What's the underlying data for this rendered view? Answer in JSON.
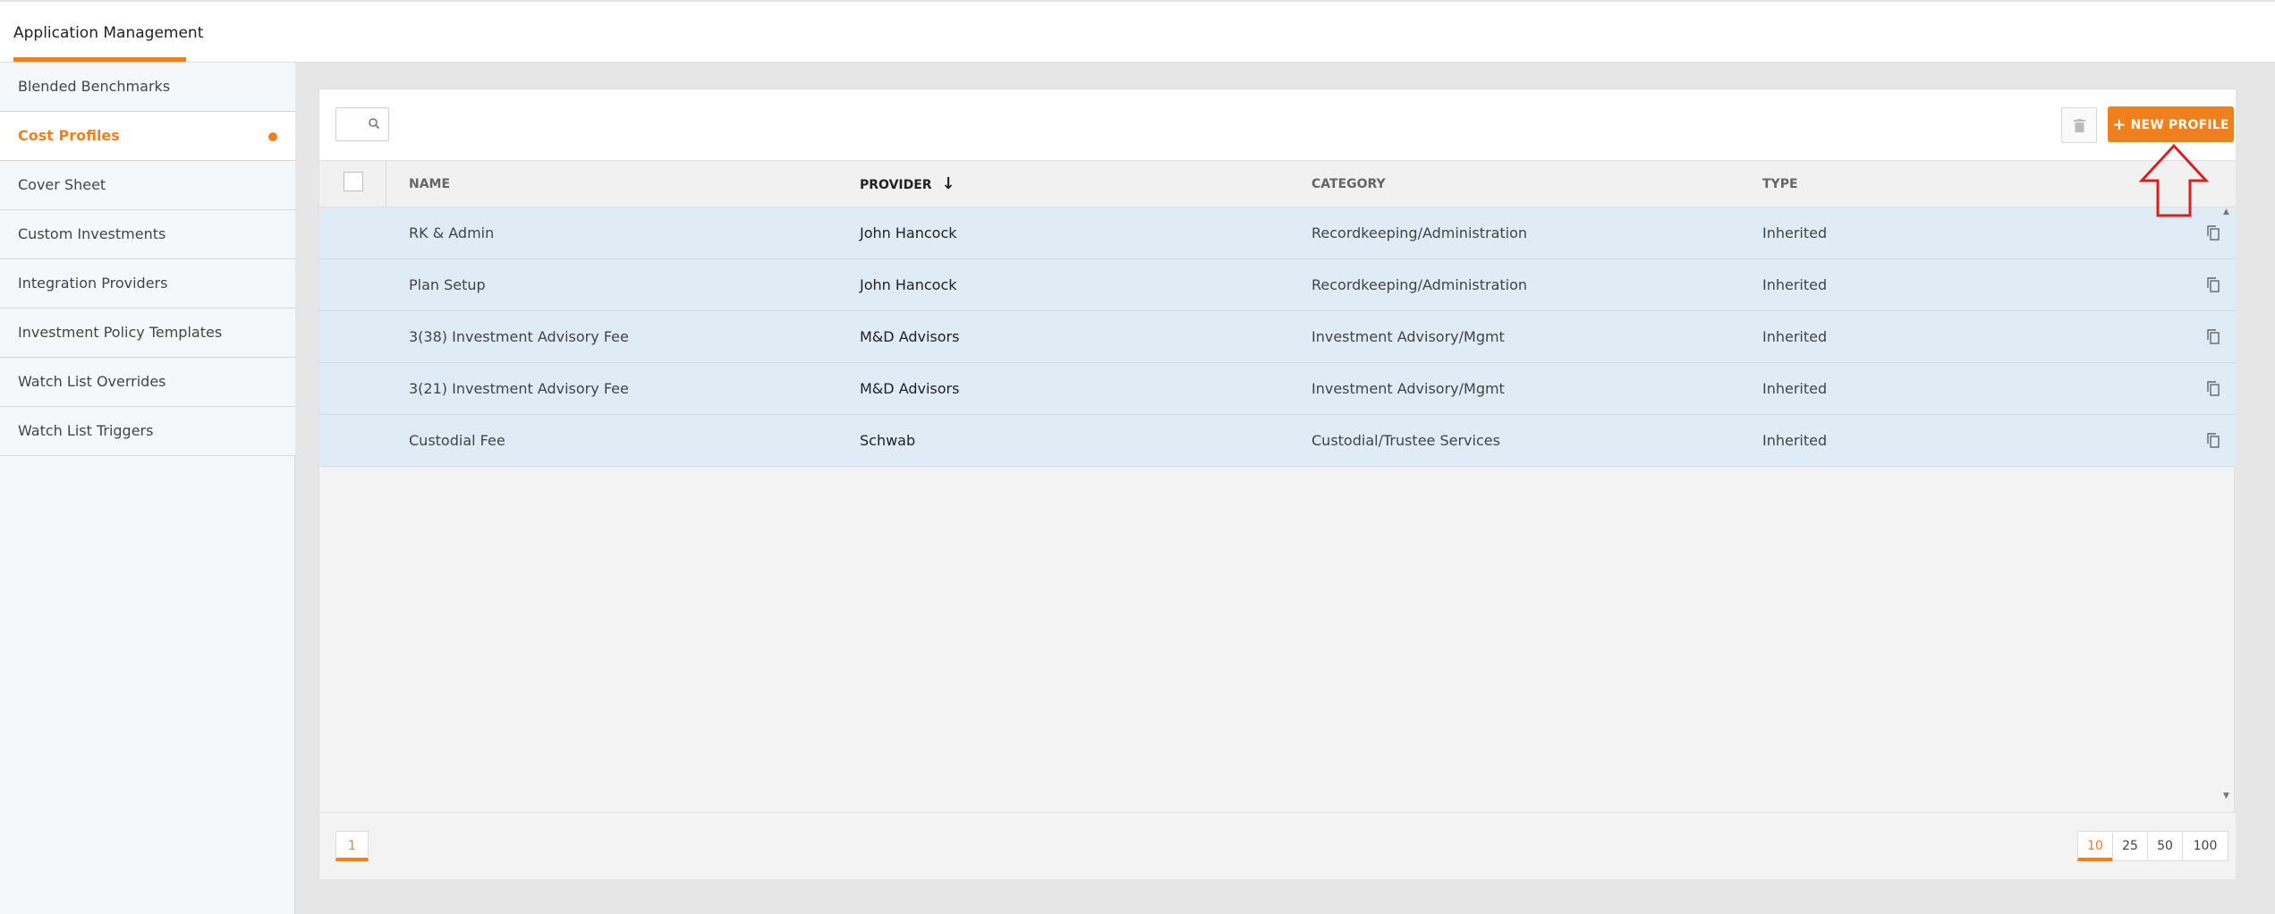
{
  "header": {
    "title": "Application Management"
  },
  "sidebar": {
    "items": [
      {
        "label": "Blended Benchmarks",
        "active": false
      },
      {
        "label": "Cost Profiles",
        "active": true
      },
      {
        "label": "Cover Sheet",
        "active": false
      },
      {
        "label": "Custom Investments",
        "active": false
      },
      {
        "label": "Integration Providers",
        "active": false
      },
      {
        "label": "Investment Policy Templates",
        "active": false
      },
      {
        "label": "Watch List Overrides",
        "active": false
      },
      {
        "label": "Watch List Triggers",
        "active": false
      }
    ]
  },
  "toolbar": {
    "search_placeholder": "",
    "new_profile_label": "NEW PROFILE",
    "new_profile_icon": "plus-icon",
    "delete_icon": "trash-icon"
  },
  "table": {
    "headers": {
      "name": "NAME",
      "provider": "PROVIDER",
      "provider_sort": "↓",
      "category": "CATEGORY",
      "type": "TYPE"
    },
    "rows": [
      {
        "name": "RK & Admin",
        "provider": "John Hancock",
        "category": "Recordkeeping/Administration",
        "type": "Inherited"
      },
      {
        "name": "Plan Setup",
        "provider": "John Hancock",
        "category": "Recordkeeping/Administration",
        "type": "Inherited"
      },
      {
        "name": "3(38) Investment Advisory Fee",
        "provider": "M&D Advisors",
        "category": "Investment Advisory/Mgmt",
        "type": "Inherited"
      },
      {
        "name": "3(21) Investment Advisory Fee",
        "provider": "M&D Advisors",
        "category": "Investment Advisory/Mgmt",
        "type": "Inherited"
      },
      {
        "name": "Custodial Fee",
        "provider": "Schwab",
        "category": "Custodial/Trustee Services",
        "type": "Inherited"
      }
    ]
  },
  "pagination": {
    "current_page": "1",
    "page_sizes": [
      "10",
      "25",
      "50",
      "100"
    ],
    "selected_size": "10"
  },
  "colors": {
    "accent": "#f07f1e",
    "row_bg": "#dfebf5",
    "annotation": "#d9201f"
  }
}
